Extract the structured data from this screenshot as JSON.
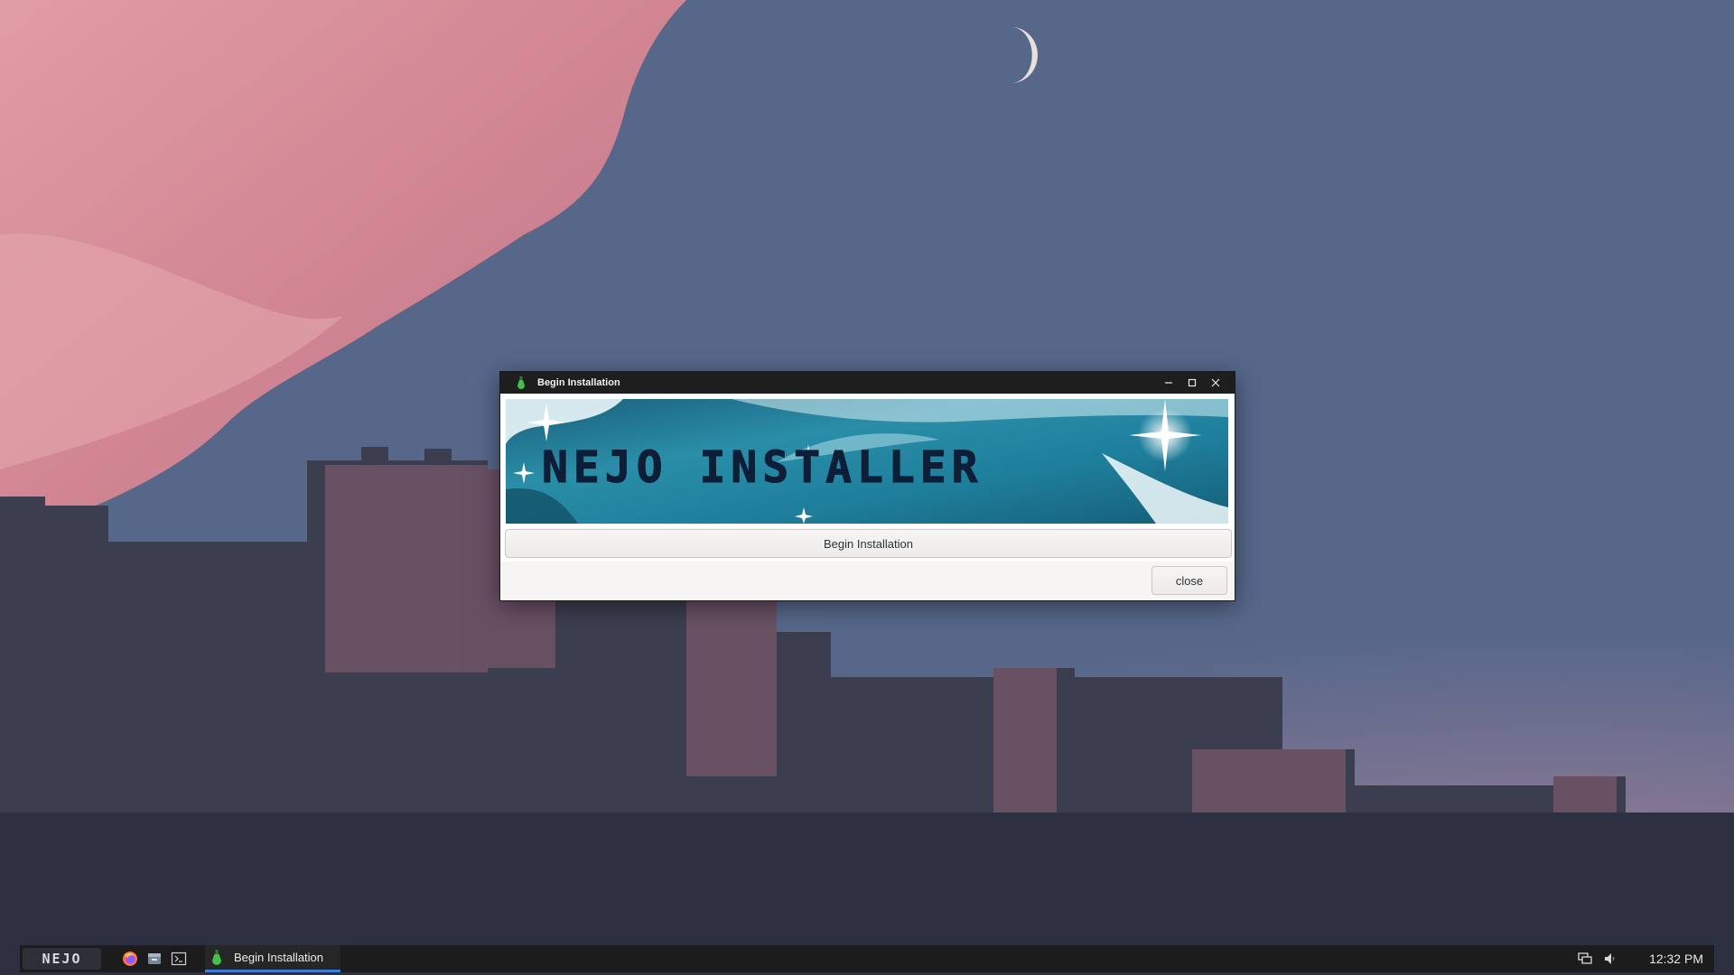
{
  "window": {
    "title": "Begin Installation",
    "app_icon": "potion-bottle-icon",
    "controls": {
      "minimize_icon": "minimize-icon",
      "maximize_icon": "maximize-icon",
      "close_icon": "close-icon"
    },
    "banner_text": "NEJO INSTALLER",
    "begin_button_label": "Begin Installation",
    "close_button_label": "close"
  },
  "taskbar": {
    "start_label": "NEJO",
    "launchers": [
      {
        "name": "firefox-icon"
      },
      {
        "name": "file-manager-icon"
      },
      {
        "name": "terminal-icon"
      }
    ],
    "task": {
      "label": "Begin Installation",
      "icon": "potion-bottle-icon"
    },
    "tray": {
      "network_icon": "network-icon",
      "volume_icon": "volume-icon",
      "clock": "12:32 PM"
    }
  },
  "colors": {
    "taskbar_bg": "#1c1c1c",
    "active_task_underline": "#3d7bd9",
    "titlebar_bg": "#1e1e1e",
    "banner_text": "#0d1f38"
  }
}
